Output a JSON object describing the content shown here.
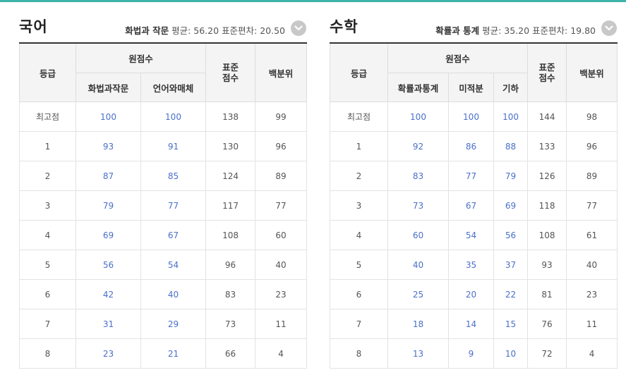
{
  "korean": {
    "title": "국어",
    "stats_selected": "화법과 작문",
    "stats_rest": " 평균: 56.20 표준편차: 20.50",
    "headers": {
      "grade": "등급",
      "raw": "원점수",
      "std_line1": "표준",
      "std_line2": "점수",
      "pct": "백분위",
      "sub": [
        "화법과작문",
        "언어와매체"
      ]
    },
    "rows": [
      {
        "grade": "최고점",
        "raw": [
          "100",
          "100"
        ],
        "std": "138",
        "pct": "99"
      },
      {
        "grade": "1",
        "raw": [
          "93",
          "91"
        ],
        "std": "130",
        "pct": "96"
      },
      {
        "grade": "2",
        "raw": [
          "87",
          "85"
        ],
        "std": "124",
        "pct": "89"
      },
      {
        "grade": "3",
        "raw": [
          "79",
          "77"
        ],
        "std": "117",
        "pct": "77"
      },
      {
        "grade": "4",
        "raw": [
          "69",
          "67"
        ],
        "std": "108",
        "pct": "60"
      },
      {
        "grade": "5",
        "raw": [
          "56",
          "54"
        ],
        "std": "96",
        "pct": "40"
      },
      {
        "grade": "6",
        "raw": [
          "42",
          "40"
        ],
        "std": "83",
        "pct": "23"
      },
      {
        "grade": "7",
        "raw": [
          "31",
          "29"
        ],
        "std": "73",
        "pct": "11"
      },
      {
        "grade": "8",
        "raw": [
          "23",
          "21"
        ],
        "std": "66",
        "pct": "4"
      }
    ]
  },
  "math": {
    "title": "수학",
    "stats_selected": "확률과 통계",
    "stats_rest": " 평균: 35.20 표준편차: 19.80",
    "headers": {
      "grade": "등급",
      "raw": "원점수",
      "std_line1": "표준",
      "std_line2": "점수",
      "pct": "백분위",
      "sub": [
        "확률과통계",
        "미적분",
        "기하"
      ]
    },
    "rows": [
      {
        "grade": "최고점",
        "raw": [
          "100",
          "100",
          "100"
        ],
        "std": "144",
        "pct": "98"
      },
      {
        "grade": "1",
        "raw": [
          "92",
          "86",
          "88"
        ],
        "std": "133",
        "pct": "96"
      },
      {
        "grade": "2",
        "raw": [
          "83",
          "77",
          "79"
        ],
        "std": "126",
        "pct": "89"
      },
      {
        "grade": "3",
        "raw": [
          "73",
          "67",
          "69"
        ],
        "std": "118",
        "pct": "77"
      },
      {
        "grade": "4",
        "raw": [
          "60",
          "54",
          "56"
        ],
        "std": "108",
        "pct": "61"
      },
      {
        "grade": "5",
        "raw": [
          "40",
          "35",
          "37"
        ],
        "std": "93",
        "pct": "40"
      },
      {
        "grade": "6",
        "raw": [
          "25",
          "20",
          "22"
        ],
        "std": "81",
        "pct": "23"
      },
      {
        "grade": "7",
        "raw": [
          "18",
          "14",
          "15"
        ],
        "std": "76",
        "pct": "11"
      },
      {
        "grade": "8",
        "raw": [
          "13",
          "9",
          "10"
        ],
        "std": "72",
        "pct": "4"
      }
    ]
  },
  "colors": {
    "accent_top": "#3bb3a8",
    "raw_score_text": "#4a6fc9",
    "header_bg": "#f4f4f4",
    "toggle_bg": "#c8c8c8"
  },
  "icons": {
    "toggle": "chevron-down-icon"
  }
}
